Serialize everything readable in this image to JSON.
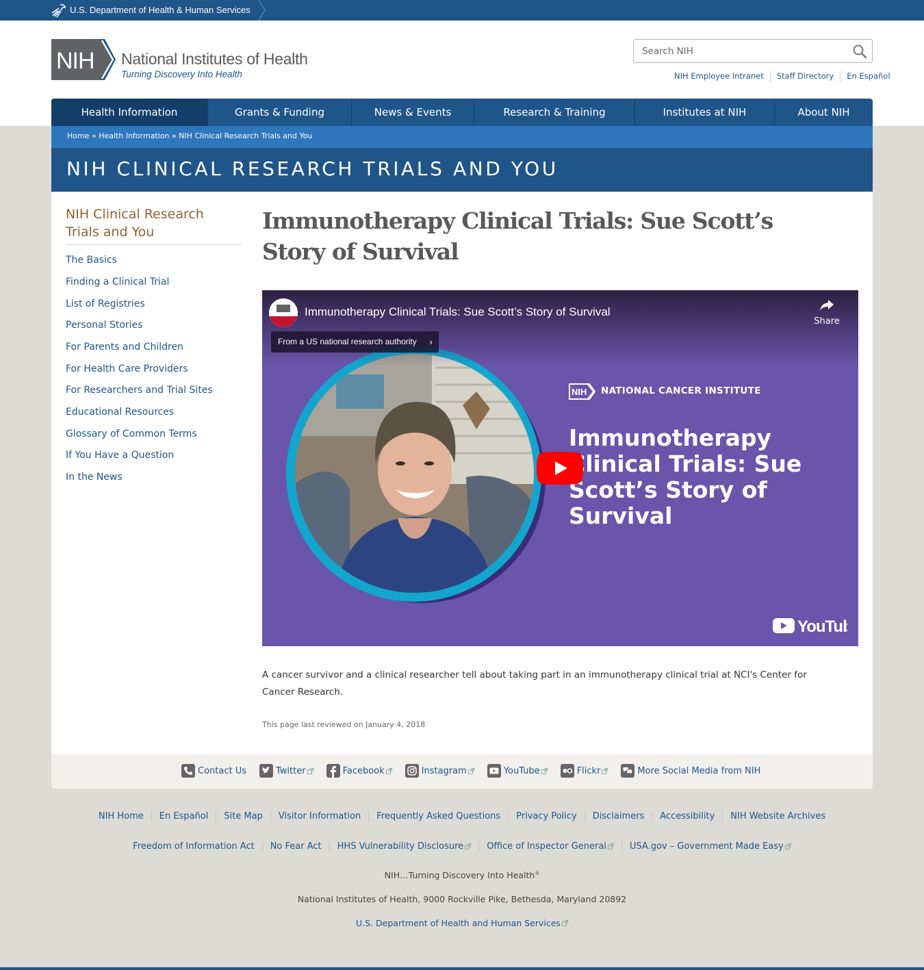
{
  "hhs_bar": {
    "label": "U.S. Department of Health & Human Services"
  },
  "header": {
    "logo_abbr": "NIH",
    "logo_name": "National Institutes of Health",
    "logo_tagline": "Turning Discovery Into Health",
    "search_placeholder": "Search NIH",
    "utility_links": [
      "NIH Employee Intranet",
      "Staff Directory",
      "En Español"
    ]
  },
  "nav": {
    "items": [
      "Health Information",
      "Grants & Funding",
      "News & Events",
      "Research & Training",
      "Institutes at NIH",
      "About NIH"
    ],
    "active": "Health Information"
  },
  "breadcrumb": {
    "items": [
      "Home",
      "Health Information",
      "NIH Clinical Research Trials and You"
    ],
    "separator": " » "
  },
  "section_title": "NIH CLINICAL RESEARCH TRIALS AND YOU",
  "sidebar": {
    "title": "NIH Clinical Research Trials and You",
    "links": [
      "The Basics",
      "Finding a Clinical Trial",
      "List of Registries",
      "Personal Stories",
      "For Parents and Children",
      "For Health Care Providers",
      "For Researchers and Trial Sites",
      "Educational Resources",
      "Glossary of Common Terms",
      "If You Have a Question",
      "In the News"
    ]
  },
  "article": {
    "title": "Immunotherapy Clinical Trials: Sue Scott’s Story of Survival",
    "description": "A cancer survivor and a clinical researcher tell about taking part in an immunotherapy clinical trial at NCI's Center for Cancer Research.",
    "reviewed": "This page last reviewed on January 4, 2018"
  },
  "video": {
    "title": "Immunotherapy Clinical Trials: Sue Scott’s Story of Survival",
    "share_label": "Share",
    "authority_chip": "From a US national research authority",
    "badge_abbr": "NIH",
    "institute": "NATIONAL CANCER INSTITUTE",
    "thumbnail_title": "Immunotherapy Clinical Trials: Sue Scott’s Story of Survival",
    "platform": "YouTube",
    "colors": {
      "background": "#6955aa",
      "ring": "#12a6cf",
      "play": "#ff0000"
    }
  },
  "social": {
    "items": [
      {
        "label": "Contact Us",
        "icon": "phone-icon",
        "external": false
      },
      {
        "label": "Twitter",
        "icon": "twitter-icon",
        "external": true
      },
      {
        "label": "Facebook",
        "icon": "facebook-icon",
        "external": true
      },
      {
        "label": "Instagram",
        "icon": "instagram-icon",
        "external": true
      },
      {
        "label": "YouTube",
        "icon": "youtube-icon",
        "external": true
      },
      {
        "label": "Flickr",
        "icon": "flickr-icon",
        "external": true
      },
      {
        "label": "More Social Media from NIH",
        "icon": "chat-icon",
        "external": false
      }
    ]
  },
  "footer": {
    "row1": [
      "NIH Home",
      "En Español",
      "Site Map",
      "Visitor Information",
      "Frequently Asked Questions",
      "Privacy Policy",
      "Disclaimers",
      "Accessibility",
      "NIH Website Archives"
    ],
    "row2": [
      {
        "label": "Freedom of Information Act",
        "external": false
      },
      {
        "label": "No Fear Act",
        "external": false
      },
      {
        "label": "HHS Vulnerability Disclosure",
        "external": true
      },
      {
        "label": "Office of Inspector General",
        "external": true
      },
      {
        "label": "USA.gov – Government Made Easy",
        "external": true
      }
    ],
    "tagline": "NIH…Turning Discovery Into Health",
    "tagline_mark": "®",
    "address": "National Institutes of Health, 9000 Rockville Pike, Bethesda, Maryland 20892",
    "hhs_link": "U.S. Department of Health and Human Services"
  },
  "colors": {
    "primary": "#20558a",
    "breadcrumb": "#2f77bd",
    "active_nav": "#133e6a",
    "sidebar_title": "#8b6532",
    "page_bg": "#dcdbd5"
  }
}
